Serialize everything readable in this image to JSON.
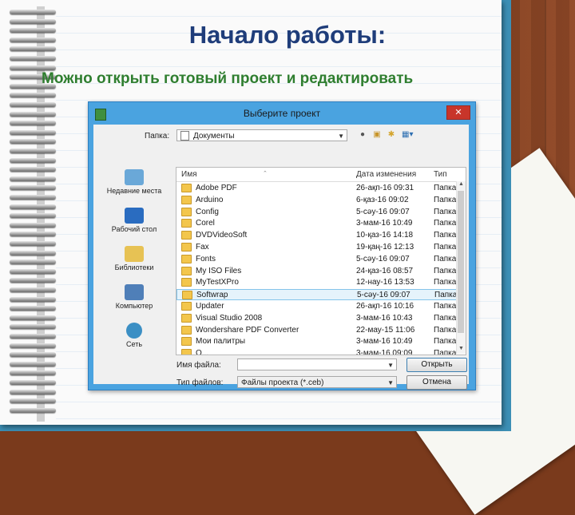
{
  "slide": {
    "title": "Начало работы:",
    "subtitle": "Можно открыть готовый проект и редактировать"
  },
  "dialog": {
    "title": "Выберите проект",
    "close_label": "✕",
    "folder_label": "Папка:",
    "folder_value": "Документы",
    "toolbar_icons": [
      "back-icon",
      "up-folder-icon",
      "new-folder-icon",
      "view-menu-icon"
    ],
    "places": [
      {
        "label": "Недавние места",
        "icon": "recent-places-icon"
      },
      {
        "label": "Рабочий стол",
        "icon": "desktop-icon"
      },
      {
        "label": "Библиотеки",
        "icon": "libraries-icon"
      },
      {
        "label": "Компьютер",
        "icon": "computer-icon"
      },
      {
        "label": "Сеть",
        "icon": "network-icon"
      }
    ],
    "columns": [
      "Имя",
      "Дата изменения",
      "Тип"
    ],
    "files": [
      {
        "name": "Adobe PDF",
        "date": "26-ақп-16 09:31",
        "type": "Папка"
      },
      {
        "name": "Arduino",
        "date": "6-қаз-16 09:02",
        "type": "Папка"
      },
      {
        "name": "Config",
        "date": "5-сәу-16 09:07",
        "type": "Папка"
      },
      {
        "name": "Corel",
        "date": "3-мам-16 10:49",
        "type": "Папка"
      },
      {
        "name": "DVDVideoSoft",
        "date": "10-қаз-16 14:18",
        "type": "Папка"
      },
      {
        "name": "Fax",
        "date": "19-қаң-16 12:13",
        "type": "Папка"
      },
      {
        "name": "Fonts",
        "date": "5-сәу-16 09:07",
        "type": "Папка"
      },
      {
        "name": "My ISO Files",
        "date": "24-қаз-16 08:57",
        "type": "Папка"
      },
      {
        "name": "MyTestXPro",
        "date": "12-нау-16 13:53",
        "type": "Папка"
      },
      {
        "name": "Softwrap",
        "date": "5-сәу-16 09:07",
        "type": "Папка",
        "selected": true
      },
      {
        "name": "Updater",
        "date": "26-ақп-16 10:16",
        "type": "Папка"
      },
      {
        "name": "Visual Studio 2008",
        "date": "3-мам-16 10:43",
        "type": "Папка"
      },
      {
        "name": "Wondershare PDF Converter",
        "date": "22-мау-15 11:06",
        "type": "Папка"
      },
      {
        "name": "Мои палитры",
        "date": "3-мам-16 10:49",
        "type": "Папка"
      },
      {
        "name": "О...",
        "date": "3-мам-16 09:09",
        "type": "Папка"
      }
    ],
    "filename_label": "Имя файла:",
    "filename_value": "",
    "filetype_label": "Тип файлов:",
    "filetype_value": "Файлы проекта (*.ceb)",
    "open_button": "Открыть",
    "cancel_button": "Отмена"
  },
  "colors": {
    "title": "#1f3d7a",
    "subtitle": "#2f7e2f",
    "dialog_frame": "#4aa3e0",
    "selection": "#e5f3fb"
  }
}
